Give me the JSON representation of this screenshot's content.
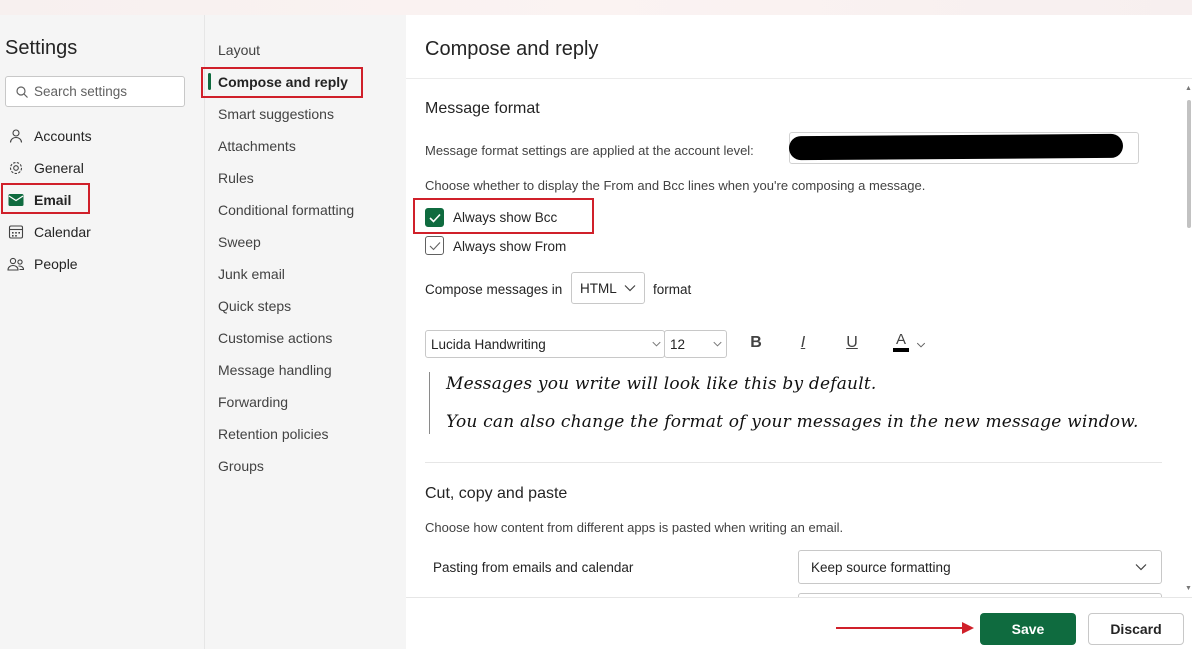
{
  "left_panel": {
    "title": "Settings",
    "search_placeholder": "Search settings",
    "items": [
      {
        "label": "Accounts",
        "icon": "person-icon"
      },
      {
        "label": "General",
        "icon": "gear-icon"
      },
      {
        "label": "Email",
        "icon": "mail-icon",
        "selected": true
      },
      {
        "label": "Calendar",
        "icon": "calendar-icon"
      },
      {
        "label": "People",
        "icon": "people-icon"
      }
    ]
  },
  "middle_panel": {
    "items": [
      "Layout",
      "Compose and reply",
      "Smart suggestions",
      "Attachments",
      "Rules",
      "Conditional formatting",
      "Sweep",
      "Junk email",
      "Quick steps",
      "Customise actions",
      "Message handling",
      "Forwarding",
      "Retention policies",
      "Groups"
    ],
    "selected": "Compose and reply"
  },
  "main": {
    "title": "Compose and reply",
    "message_format": {
      "heading": "Message format",
      "account_level_text": "Message format settings are applied at the account level:",
      "from_bcc_desc": "Choose whether to display the From and Bcc lines when you're composing a message.",
      "always_show_bcc": {
        "label": "Always show Bcc",
        "checked": true
      },
      "always_show_from": {
        "label": "Always show From",
        "checked": false
      },
      "compose_prefix": "Compose messages in",
      "compose_format": "HTML",
      "compose_suffix": "format",
      "font_family": "Lucida Handwriting",
      "font_size": "12",
      "bold_label": "B",
      "italic_label": "I",
      "underline_label": "U",
      "font_color_label": "A",
      "sample_line_1": "Messages you write will look like this by default.",
      "sample_line_2": "You can also change the format of your messages in the new message window."
    },
    "cut_copy_paste": {
      "heading": "Cut, copy and paste",
      "desc": "Choose how content from different apps is pasted when writing an email.",
      "pasting_label": "Pasting from emails and calendar",
      "pasting_value": "Keep source formatting"
    }
  },
  "footer": {
    "save_label": "Save",
    "discard_label": "Discard"
  },
  "colors": {
    "accent": "#0f6b3f",
    "highlight": "#d0202a"
  }
}
